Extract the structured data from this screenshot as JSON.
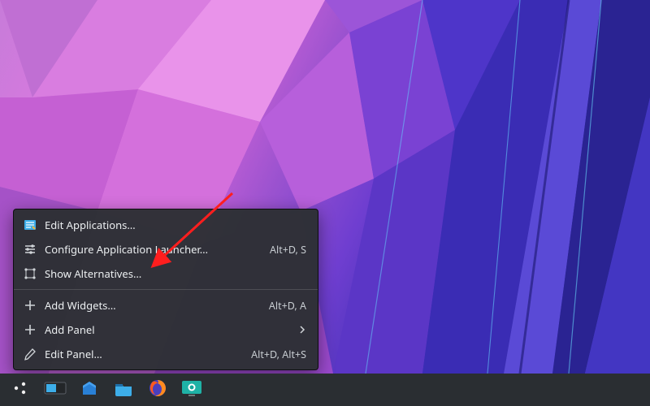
{
  "menu": {
    "groups": [
      [
        {
          "id": "edit-applications",
          "label": "Edit Applications…",
          "icon": "edit-apps-icon",
          "shortcut": ""
        },
        {
          "id": "configure-launcher",
          "label": "Configure Application Launcher…",
          "icon": "configure-icon",
          "shortcut": "Alt+D, S"
        },
        {
          "id": "show-alternatives",
          "label": "Show Alternatives…",
          "icon": "alternatives-icon",
          "shortcut": ""
        }
      ],
      [
        {
          "id": "add-widgets",
          "label": "Add Widgets…",
          "icon": "plus-icon",
          "shortcut": "Alt+D, A"
        },
        {
          "id": "add-panel",
          "label": "Add Panel",
          "icon": "plus-icon",
          "submenu": true
        },
        {
          "id": "edit-panel",
          "label": "Edit Panel…",
          "icon": "pencil-icon",
          "shortcut": "Alt+D, Alt+S"
        }
      ]
    ]
  },
  "taskbar": {
    "items": [
      {
        "id": "app-launcher",
        "icon": "kde-launcher-icon"
      },
      {
        "id": "pager",
        "icon": "pager-icon"
      },
      {
        "id": "discover",
        "icon": "discover-icon"
      },
      {
        "id": "dolphin",
        "icon": "dolphin-icon"
      },
      {
        "id": "firefox",
        "icon": "firefox-icon"
      },
      {
        "id": "spectacle",
        "icon": "spectacle-icon"
      }
    ]
  },
  "annotation": {
    "points_to": "show-alternatives",
    "color": "#ff1e1e"
  }
}
